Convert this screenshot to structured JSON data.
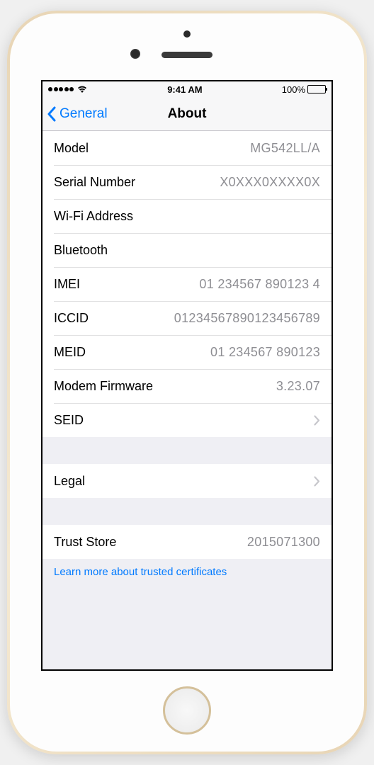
{
  "status_bar": {
    "time": "9:41 AM",
    "battery_percent": "100%"
  },
  "nav": {
    "back_label": "General",
    "title": "About"
  },
  "rows": {
    "model": {
      "label": "Model",
      "value": "MG542LL/A"
    },
    "serial": {
      "label": "Serial Number",
      "value": "X0XXX0XXXX0X"
    },
    "wifi": {
      "label": "Wi-Fi Address",
      "value": ""
    },
    "bluetooth": {
      "label": "Bluetooth",
      "value": ""
    },
    "imei": {
      "label": "IMEI",
      "value": "01 234567 890123 4"
    },
    "iccid": {
      "label": "ICCID",
      "value": "01234567890123456789"
    },
    "meid": {
      "label": "MEID",
      "value": "01 234567 890123"
    },
    "modem": {
      "label": "Modem Firmware",
      "value": "3.23.07"
    },
    "seid": {
      "label": "SEID"
    },
    "legal": {
      "label": "Legal"
    },
    "trust": {
      "label": "Trust Store",
      "value": "2015071300"
    }
  },
  "footer": {
    "link": "Learn more about trusted certificates"
  }
}
